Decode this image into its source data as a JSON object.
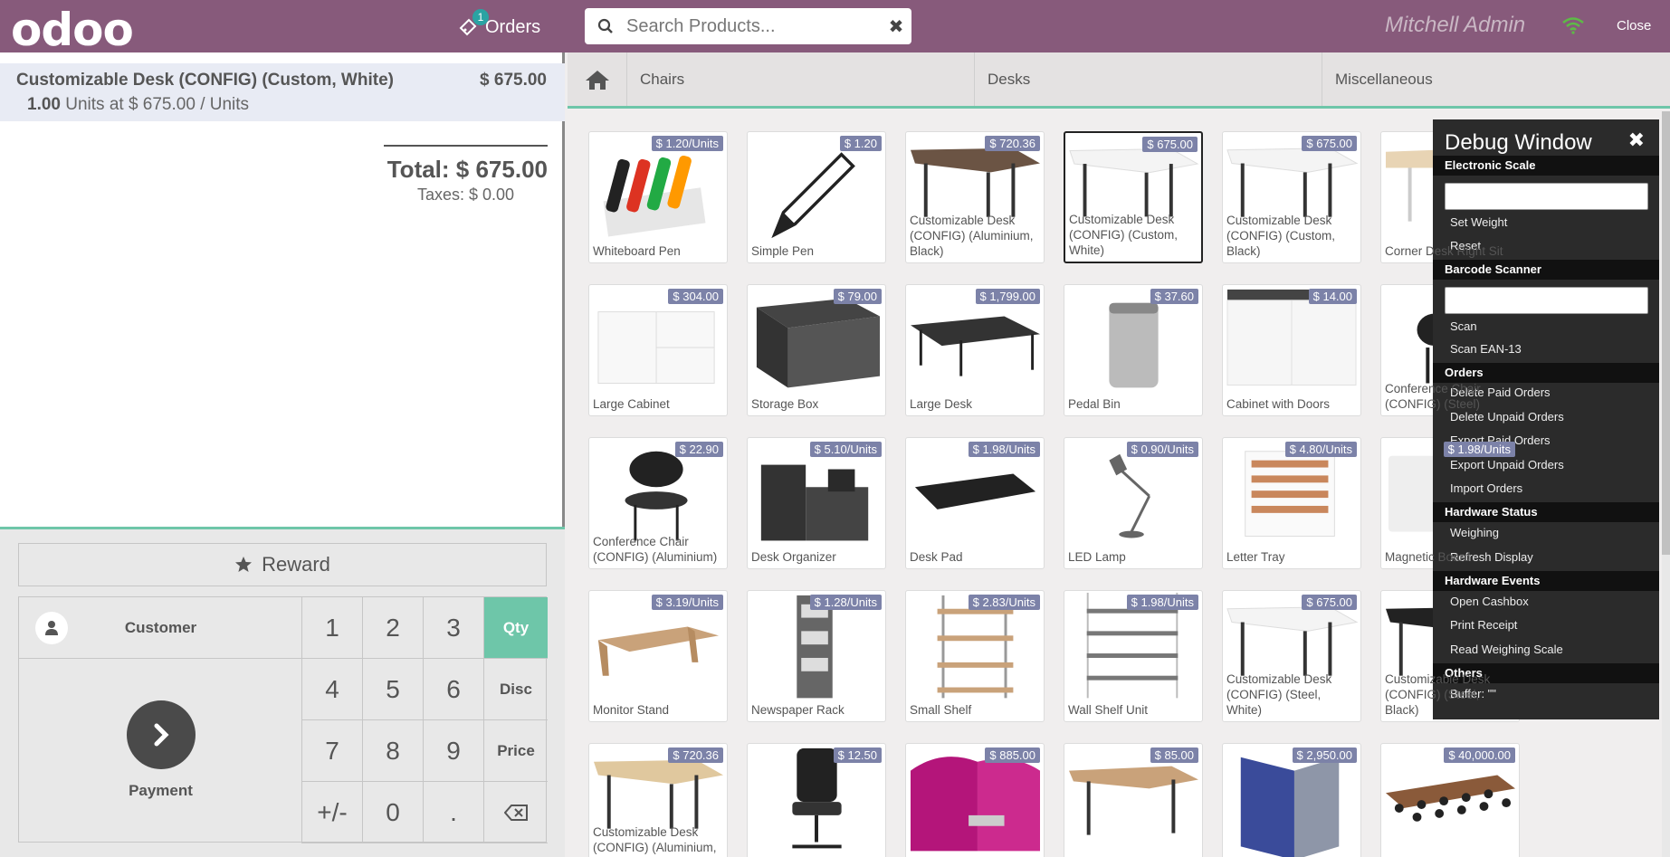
{
  "header": {
    "logo": "odoo",
    "orders_label": "Orders",
    "orders_count": "1",
    "search_placeholder": "Search Products...",
    "clear_icon": "✖",
    "user_name": "Mitchell Admin",
    "close_label": "Close"
  },
  "order": {
    "line_name": "Customizable Desk (CONFIG) (Custom, White)",
    "line_price": "$ 675.00",
    "line_qty": "1.00",
    "line_unit_info": "Units at $ 675.00 / Units",
    "total": "Total: $ 675.00",
    "taxes": "Taxes: $ 0.00"
  },
  "actions": {
    "reward": "Reward",
    "customer": "Customer",
    "payment": "Payment"
  },
  "numpad": [
    "1",
    "2",
    "3",
    "Qty",
    "4",
    "5",
    "6",
    "Disc",
    "7",
    "8",
    "9",
    "Price",
    "+/-",
    "0",
    "."
  ],
  "categories": [
    "Chairs",
    "Desks",
    "Miscellaneous"
  ],
  "products": [
    {
      "name": "Whiteboard Pen",
      "price": "$ 1.20/Units"
    },
    {
      "name": "Simple Pen",
      "price": "$ 1.20"
    },
    {
      "name": "Customizable Desk (CONFIG) (Aluminium, Black)",
      "price": "$ 720.36"
    },
    {
      "name": "Customizable Desk (CONFIG) (Custom, White)",
      "price": "$ 675.00"
    },
    {
      "name": "Customizable Desk (CONFIG) (Custom, Black)",
      "price": "$ 675.00"
    },
    {
      "name": "Corner Desk Right Sit",
      "price": ""
    },
    {
      "name": "Large Cabinet",
      "price": "$ 304.00"
    },
    {
      "name": "Storage Box",
      "price": "$ 79.00"
    },
    {
      "name": "Large Desk",
      "price": "$ 1,799.00"
    },
    {
      "name": "Pedal Bin",
      "price": "$ 37.60"
    },
    {
      "name": "Cabinet with Doors",
      "price": "$ 14.00"
    },
    {
      "name": "Conference Chair (CONFIG) (Steel)",
      "price": ""
    },
    {
      "name": "Conference Chair (CONFIG) (Aluminium)",
      "price": "$ 22.90"
    },
    {
      "name": "Desk Organizer",
      "price": "$ 5.10/Units"
    },
    {
      "name": "Desk Pad",
      "price": "$ 1.98/Units"
    },
    {
      "name": "LED Lamp",
      "price": "$ 0.90/Units"
    },
    {
      "name": "Letter Tray",
      "price": "$ 4.80/Units"
    },
    {
      "name": "Magnetic Board",
      "price": "$ 1.98/Units"
    },
    {
      "name": "Monitor Stand",
      "price": "$ 3.19/Units"
    },
    {
      "name": "Newspaper Rack",
      "price": "$ 1.28/Units"
    },
    {
      "name": "Small Shelf",
      "price": "$ 2.83/Units"
    },
    {
      "name": "Wall Shelf Unit",
      "price": "$ 1.98/Units"
    },
    {
      "name": "Customizable Desk (CONFIG) (Steel, White)",
      "price": "$ 675.00"
    },
    {
      "name": "Customizable Desk (CONFIG) (Steel, Black)",
      "price": ""
    },
    {
      "name": "Customizable Desk (CONFIG) (Aluminium, White)",
      "price": "$ 720.36"
    },
    {
      "name": "",
      "price": "$ 12.50"
    },
    {
      "name": "",
      "price": "$ 885.00"
    },
    {
      "name": "",
      "price": "$ 85.00"
    },
    {
      "name": "",
      "price": "$ 2,950.00"
    },
    {
      "name": "",
      "price": "$ 40,000.00"
    }
  ],
  "debug": {
    "title": "Debug Window",
    "close_icon": "✖",
    "scale_section": "Electronic Scale",
    "set_weight": "Set Weight",
    "reset": "Reset",
    "barcode_section": "Barcode Scanner",
    "scan": "Scan",
    "scan_ean": "Scan EAN-13",
    "orders_section": "Orders",
    "delete_paid": "Delete Paid Orders",
    "delete_unpaid": "Delete Unpaid Orders",
    "export_paid": "Export Paid Orders",
    "export_unpaid": "Export Unpaid Orders",
    "import_orders": "Import Orders",
    "hw_status_section": "Hardware Status",
    "weighing": "Weighing",
    "refresh_display": "Refresh Display",
    "hw_events_section": "Hardware Events",
    "open_cashbox": "Open Cashbox",
    "print_receipt": "Print Receipt",
    "read_scale": "Read Weighing Scale",
    "others_section": "Others",
    "buffer": "Buffer: \"\""
  },
  "colors": {
    "brand": "#875a7b",
    "accent": "#6ec6a9",
    "price_tag": "#7c82a8",
    "wifi": "#5dbb46"
  }
}
